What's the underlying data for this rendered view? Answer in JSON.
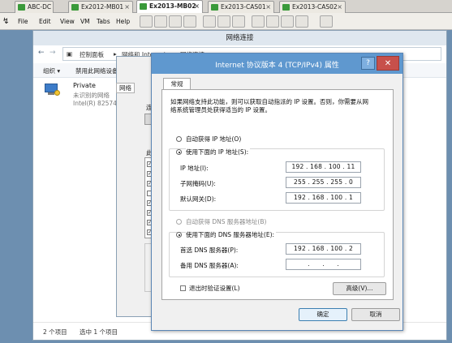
{
  "vm_tabs": [
    {
      "label": "ABC-DC",
      "active": false
    },
    {
      "label": "Ex2012-MB01",
      "active": false
    },
    {
      "label": "Ex2013-MB02",
      "active": true
    },
    {
      "label": "Ex2013-CAS01",
      "active": false
    },
    {
      "label": "Ex2013-CAS02",
      "active": false
    }
  ],
  "menu": [
    "File",
    "Edit",
    "View",
    "VM",
    "Tabs",
    "Help"
  ],
  "explorer": {
    "title": "网络连接",
    "breadcrumb": [
      "控制面板",
      "网络和 Internet",
      "网络连接"
    ],
    "commands": [
      "组织 ▾",
      "禁用此网络设备"
    ],
    "adapter": {
      "name": "Private",
      "status": "未识别的网络",
      "device": "Intel(R) 82574L"
    },
    "status_count": "2 个项目",
    "status_selected": "选中 1 个项目"
  },
  "properties_dialog": {
    "tab": "网络",
    "connect_label": "连接",
    "items_label": "此连"
  },
  "tcp_dialog": {
    "title": "Internet 协议版本 4 (TCP/IPv4) 属性",
    "help": "?",
    "close": "✕",
    "tab": "常规",
    "desc_line1": "如果网络支持此功能，则可以获取自动指派的 IP 设置。否则，你需要从网",
    "desc_line2": "络系统管理员处获得适当的 IP 设置。",
    "radio_auto_ip": "自动获得 IP 地址(O)",
    "radio_manual_ip": "使用下面的 IP 地址(S):",
    "ip_label": "IP 地址(I):",
    "ip_value": "192 . 168 . 100 . 11",
    "mask_label": "子网掩码(U):",
    "mask_value": "255 . 255 . 255 . 0",
    "gateway_label": "默认网关(D):",
    "gateway_value": "192 . 168 . 100 . 1",
    "radio_auto_dns": "自动获得 DNS 服务器地址(B)",
    "radio_manual_dns": "使用下面的 DNS 服务器地址(E):",
    "dns1_label": "首选 DNS 服务器(P):",
    "dns1_value": "192 . 168 . 100 . 2",
    "dns2_label": "备用 DNS 服务器(A):",
    "dns2_value": ".      .      .",
    "validate_label": "退出时验证设置(L)",
    "advanced": "高级(V)...",
    "ok": "确定",
    "cancel": "取消"
  }
}
